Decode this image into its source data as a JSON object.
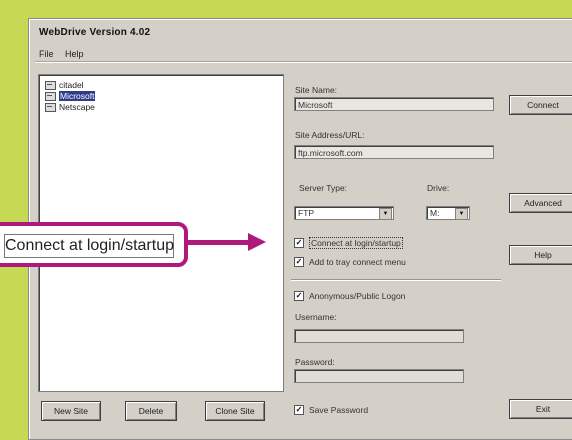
{
  "window": {
    "title": "WebDrive Version 4.02"
  },
  "menu": [
    "File",
    "Help"
  ],
  "sites": [
    {
      "label": "citadel",
      "selected": false
    },
    {
      "label": "Microsoft",
      "selected": true
    },
    {
      "label": "Netscape",
      "selected": false
    }
  ],
  "list_buttons": {
    "new_site": "New Site",
    "delete": "Delete",
    "clone_site": "Clone Site"
  },
  "form": {
    "site_name_label": "Site Name:",
    "site_name_value": "Microsoft",
    "site_address_label": "Site Address/URL:",
    "site_address_value": "ftp.microsoft.com",
    "server_type_label": "Server Type:",
    "server_type_value": "FTP",
    "drive_label": "Drive:",
    "drive_value": "M:",
    "connect_at_login_label": "Connect at login/startup",
    "connect_at_login_checked": true,
    "add_to_tray_label": "Add to tray connect menu",
    "add_to_tray_checked": true,
    "anonymous_label": "Anonymous/Public Logon",
    "anonymous_checked": true,
    "username_label": "Username:",
    "username_value": "",
    "password_label": "Password:",
    "password_value": "",
    "save_password_label": "Save Password",
    "save_password_checked": true
  },
  "side_buttons": {
    "connect": "Connect",
    "advanced": "Advanced",
    "help": "Help",
    "exit": "Exit"
  },
  "callout": {
    "text": "Connect at login/startup"
  },
  "colors": {
    "background": "#c5d955",
    "callout_accent": "#b0197c",
    "selection": "#2e3c8c"
  }
}
